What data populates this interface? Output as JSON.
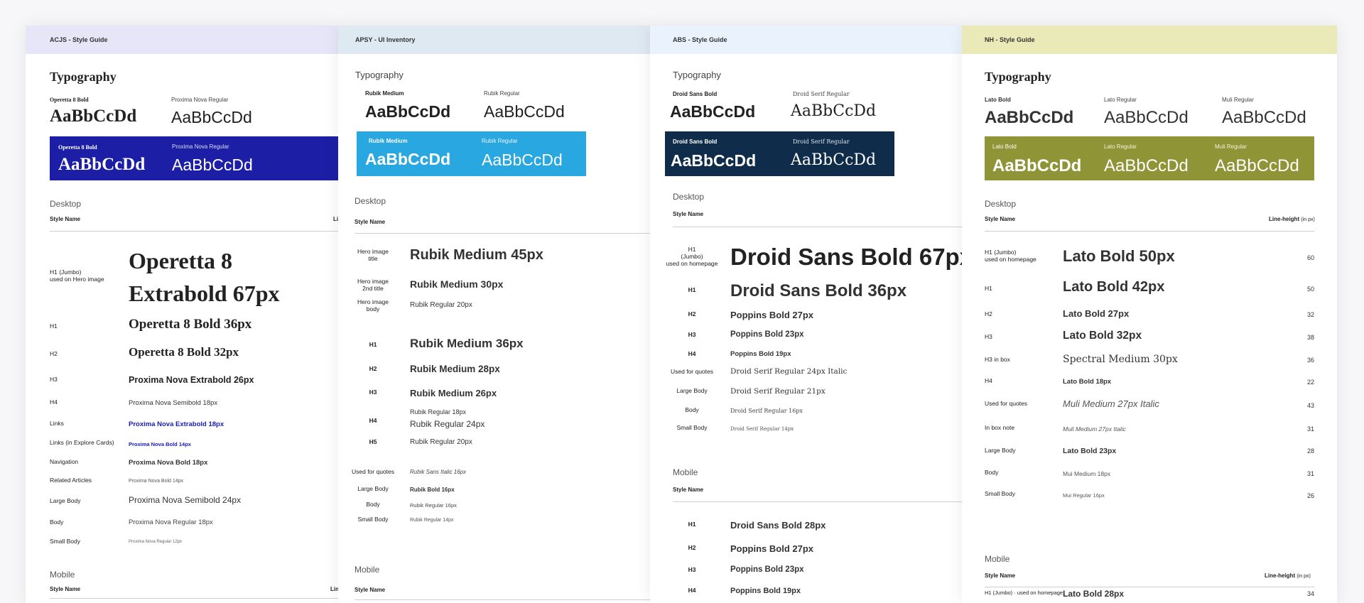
{
  "p1": {
    "header": "ACJS - Style Guide",
    "title": "Typography",
    "f1": "Operetta 8 Bold",
    "f2": "Proxima Nova Regular",
    "f1b": "Operetta 8 Bold",
    "f2b": "Proxima Nova Regular",
    "sample": "AaBbCcDd",
    "desktop": "Desktop",
    "stylename": "Style Name",
    "lh": "Li",
    "h1label": "H1 (Jumbo)",
    "h1note": "used on Hero image",
    "h1a": "Operetta 8",
    "h1b": "Extrabold 67px",
    "rows": [
      {
        "l": "H1",
        "s": "Operetta 8 Bold 36px"
      },
      {
        "l": "H2",
        "s": "Operetta 8 Bold 32px"
      },
      {
        "l": "H3",
        "s": "Proxima Nova Extrabold 26px"
      },
      {
        "l": "H4",
        "s": "Proxima Nova Semibold 18px"
      },
      {
        "l": "Links",
        "s": "Proxima Nova Extrabold 18px"
      },
      {
        "l": "Links (in Explore Cards)",
        "s": "Proxima Nova Bold 14px"
      },
      {
        "l": "Navigation",
        "s": "Proxima Nova Bold 18px"
      },
      {
        "l": "Related Articles",
        "s": "Proxima Nova Bold 14px"
      },
      {
        "l": "Large Body",
        "s": "Proxima Nova Semibold 24px"
      },
      {
        "l": "Body",
        "s": "Proxima Nova Regular 18px"
      },
      {
        "l": "Small Body",
        "s": "Proxima Nova Regular 12px"
      }
    ],
    "mobile": "Mobile",
    "stylename2": "Style Name",
    "lh2": "Lin",
    "colors": {
      "header": "#e6e6f8",
      "box": "#1c1fa5",
      "link": "#1a1ab8"
    }
  },
  "p2": {
    "header": "APSY - UI Inventory",
    "title": "Typography",
    "f1": "Rubik Medium",
    "f2": "Rubik Regular",
    "f1b": "Rubik Medium",
    "f2b": "Rubik Regular",
    "sample": "AaBbCcDd",
    "desktop": "Desktop",
    "stylename": "Style Name",
    "rows": [
      {
        "l": "Hero image title",
        "s": "Rubik Medium 45px"
      },
      {
        "l": "Hero image 2nd title",
        "s": "Rubik Medium 30px"
      },
      {
        "l": "Hero image body",
        "s": "Rubik Regular 20px"
      },
      {
        "l": "H1",
        "s": "Rubik Medium 36px"
      },
      {
        "l": "H2",
        "s": "Rubik Medium 28px"
      },
      {
        "l": "H3",
        "s": "Rubik Medium 26px"
      },
      {
        "l": "H4",
        "s": "Rubik Regular 18px",
        "s2": "Rubik Regular 24px"
      },
      {
        "l": "H5",
        "s": "Rubik Regular 20px"
      },
      {
        "l": "Used for quotes",
        "s": "Rubik Sans Italic 16px"
      },
      {
        "l": "Large Body",
        "s": "Rubik Bold 16px"
      },
      {
        "l": "Body",
        "s": "Rubik Regular 16px"
      },
      {
        "l": "Small Body",
        "s": "Rubik Regular 14px"
      }
    ],
    "mobile": "Mobile",
    "stylename2": "Style Name",
    "colors": {
      "header": "#dfe9f2",
      "box": "#29a7e1"
    }
  },
  "p3": {
    "header": "ABS - Style Guide",
    "title": "Typography",
    "f1": "Droid Sans Bold",
    "f2": "Droid Serif Regular",
    "f1b": "Droid Sans Bold",
    "f2b": "Droid Serif Regular",
    "sample": "AaBbCcDd",
    "desktop": "Desktop",
    "stylename": "Style Name",
    "h1label": "H1",
    "h1note1": "(Jumbo)",
    "h1note2": "used on homepage",
    "h1s": "Droid Sans Bold 67px",
    "rows": [
      {
        "l": "H1",
        "s": "Droid Sans Bold 36px"
      },
      {
        "l": "H2",
        "s": "Poppins Bold 27px"
      },
      {
        "l": "H3",
        "s": "Poppins Bold 23px"
      },
      {
        "l": "H4",
        "s": "Poppins Bold 19px"
      },
      {
        "l": "Used for quotes",
        "s": "Droid Serif Regular 24px Italic"
      },
      {
        "l": "Large Body",
        "s": "Droid Serif Regular 21px"
      },
      {
        "l": "Body",
        "s": "Droid Serif Regular 16px"
      },
      {
        "l": "Small Body",
        "s": "Droid Serif Regular 14px"
      }
    ],
    "mobile": "Mobile",
    "stylename2": "Style Name",
    "mrows": [
      {
        "l": "H1",
        "s": "Droid Sans Bold 28px"
      },
      {
        "l": "H2",
        "s": "Poppins Bold 27px"
      },
      {
        "l": "H3",
        "s": "Poppins Bold 23px"
      },
      {
        "l": "H4",
        "s": "Poppins Bold 19px"
      }
    ],
    "colors": {
      "header": "#e9f2fd",
      "box": "#0f2c4a"
    }
  },
  "p4": {
    "header": "NH - Style Guide",
    "title": "Typography",
    "f1": "Lato Bold",
    "f2": "Lato Regular",
    "f3": "Muli Regular",
    "f1b": "Lato Bold",
    "f2b": "Lato Regular",
    "f3b": "Muli Regular",
    "sample": "AaBbCcDd",
    "desktop": "Desktop",
    "stylename": "Style Name",
    "lh": "Line-height",
    "lhunit": "(in px)",
    "h1label": "H1 (Jumbo)",
    "h1note": "used on homepage",
    "h1s": "Lato Bold 50px",
    "h1n": "60",
    "rows": [
      {
        "l": "H1",
        "s": "Lato Bold 42px",
        "n": "50"
      },
      {
        "l": "H2",
        "s": "Lato Bold 27px",
        "n": "32"
      },
      {
        "l": "H3",
        "s": "Lato Bold 32px",
        "n": "38"
      },
      {
        "l": "H3 in box",
        "s": "Spectral Medium 30px",
        "n": "36"
      },
      {
        "l": "H4",
        "s": "Lato Bold 18px",
        "n": "22"
      },
      {
        "l": "Used for quotes",
        "s": "Muli Medium 27px Italic",
        "n": "43"
      },
      {
        "l": "In box note",
        "s": "Muli Medium 27px Italic",
        "n": "31"
      },
      {
        "l": "Large Body",
        "s": "Lato Bold 23px",
        "n": "28"
      },
      {
        "l": "Body",
        "s": "Mui Medium 18px",
        "n": "31"
      },
      {
        "l": "Small Body",
        "s": "Mui Regular 16px",
        "n": "26"
      }
    ],
    "mobile": "Mobile",
    "stylename2": "Style Name",
    "lh2": "Line-height",
    "lhunit2": "(in px)",
    "mh1label": "H1 (Jumbo)",
    "mh1note": "used on homepage",
    "mh1s": "Lato Bold 28px",
    "mh1n": "34",
    "colors": {
      "header": "#eaeab9",
      "box": "#8f9436"
    }
  }
}
